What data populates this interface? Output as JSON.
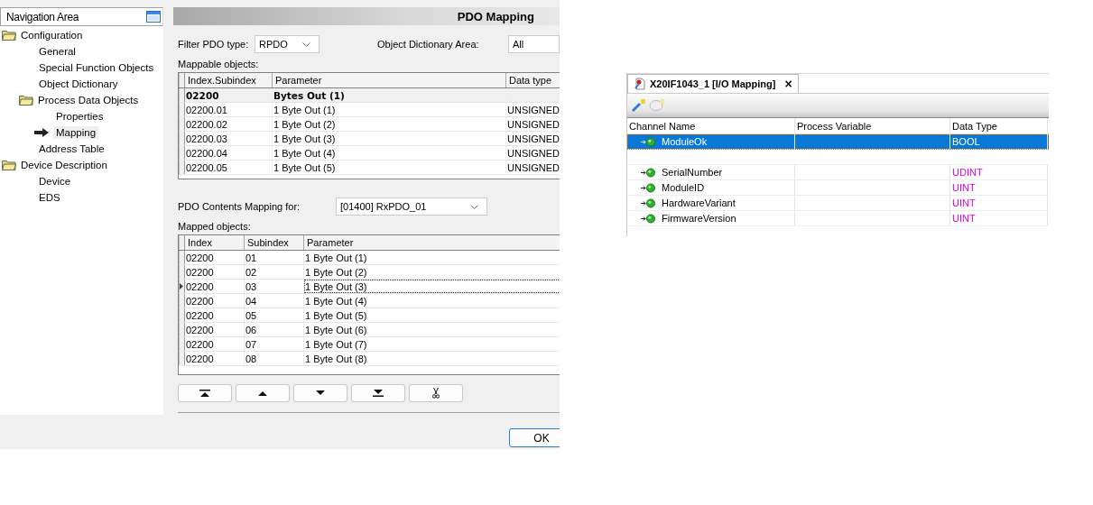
{
  "navigation": {
    "title": "Navigation Area",
    "items": [
      {
        "label": "Configuration",
        "kind": "folder",
        "children": [
          {
            "label": "General",
            "kind": "leaf",
            "selected": false
          },
          {
            "label": "Special Function Objects",
            "kind": "leaf",
            "selected": false
          },
          {
            "label": "Object Dictionary",
            "kind": "leaf",
            "selected": false
          },
          {
            "label": "Process Data Objects",
            "kind": "folder",
            "children": [
              {
                "label": "Properties",
                "kind": "leaf",
                "selected": false
              },
              {
                "label": "Mapping",
                "kind": "leaf",
                "selected": true
              }
            ]
          },
          {
            "label": "Address Table",
            "kind": "leaf",
            "selected": false
          }
        ]
      },
      {
        "label": "Device Description",
        "kind": "folder",
        "children": [
          {
            "label": "Device",
            "kind": "leaf",
            "selected": false
          },
          {
            "label": "EDS",
            "kind": "leaf",
            "selected": false
          }
        ]
      }
    ]
  },
  "pdo_mapping": {
    "title": "PDO Mapping",
    "filter_label": "Filter PDO type:",
    "filter_value": "RPDO",
    "area_label": "Object Dictionary Area:",
    "area_value": "All",
    "mappable_label": "Mappable objects:",
    "mappable_columns": [
      "Index.Subindex",
      "Parameter",
      "Data type"
    ],
    "mappable_rows": [
      {
        "kind": "group",
        "cells": [
          "02200",
          "Bytes Out (1)"
        ]
      },
      {
        "kind": "item",
        "cells": [
          "02200.01",
          "1 Byte Out (1)",
          "UNSIGNED"
        ]
      },
      {
        "kind": "item",
        "cells": [
          "02200.02",
          "1 Byte Out (2)",
          "UNSIGNED"
        ]
      },
      {
        "kind": "item",
        "cells": [
          "02200.03",
          "1 Byte Out (3)",
          "UNSIGNED"
        ]
      },
      {
        "kind": "item",
        "cells": [
          "02200.04",
          "1 Byte Out (4)",
          "UNSIGNED"
        ]
      },
      {
        "kind": "item",
        "cells": [
          "02200.05",
          "1 Byte Out (5)",
          "UNSIGNED"
        ]
      }
    ],
    "contents_label": "PDO Contents Mapping for:",
    "contents_value": "[01400] RxPDO_01",
    "mapped_label": "Mapped objects:",
    "mapped_columns": [
      "Index",
      "Subindex",
      "Parameter"
    ],
    "mapped_rows": [
      {
        "selected": false,
        "cells": [
          "02200",
          "01",
          "1 Byte Out (1)"
        ]
      },
      {
        "selected": false,
        "cells": [
          "02200",
          "02",
          "1 Byte Out (2)"
        ]
      },
      {
        "selected": true,
        "cells": [
          "02200",
          "03",
          "1 Byte Out (3)"
        ]
      },
      {
        "selected": false,
        "cells": [
          "02200",
          "04",
          "1 Byte Out (4)"
        ]
      },
      {
        "selected": false,
        "cells": [
          "02200",
          "05",
          "1 Byte Out (5)"
        ]
      },
      {
        "selected": false,
        "cells": [
          "02200",
          "06",
          "1 Byte Out (6)"
        ]
      },
      {
        "selected": false,
        "cells": [
          "02200",
          "07",
          "1 Byte Out (7)"
        ]
      },
      {
        "selected": false,
        "cells": [
          "02200",
          "08",
          "1 Byte Out (8)"
        ]
      }
    ],
    "buttons": [
      {
        "kind": "top"
      },
      {
        "kind": "up"
      },
      {
        "kind": "down"
      },
      {
        "kind": "bottom"
      },
      {
        "kind": "cut"
      }
    ],
    "ok_button": "OK"
  },
  "io_mapping": {
    "tab": "X20IF1043_1 [I/O Mapping]",
    "tab_close": "×",
    "columns": [
      "Channel Name",
      "Process Variable",
      "Data Type"
    ],
    "rows": [
      {
        "kind": "channel",
        "selected": true,
        "name": "ModuleOk",
        "type": "BOOL"
      },
      {
        "kind": "blank"
      },
      {
        "kind": "channel",
        "selected": false,
        "name": "SerialNumber",
        "type": "UDINT",
        "color": "#e000e0"
      },
      {
        "kind": "channel",
        "selected": false,
        "name": "ModuleID",
        "type": "UINT",
        "color": "#e000e0"
      },
      {
        "kind": "channel",
        "selected": false,
        "name": "HardwareVariant",
        "type": "UINT",
        "color": "#e000e0"
      },
      {
        "kind": "channel",
        "selected": false,
        "name": "FirmwareVersion",
        "type": "UINT",
        "color": "#e000e0"
      }
    ]
  }
}
